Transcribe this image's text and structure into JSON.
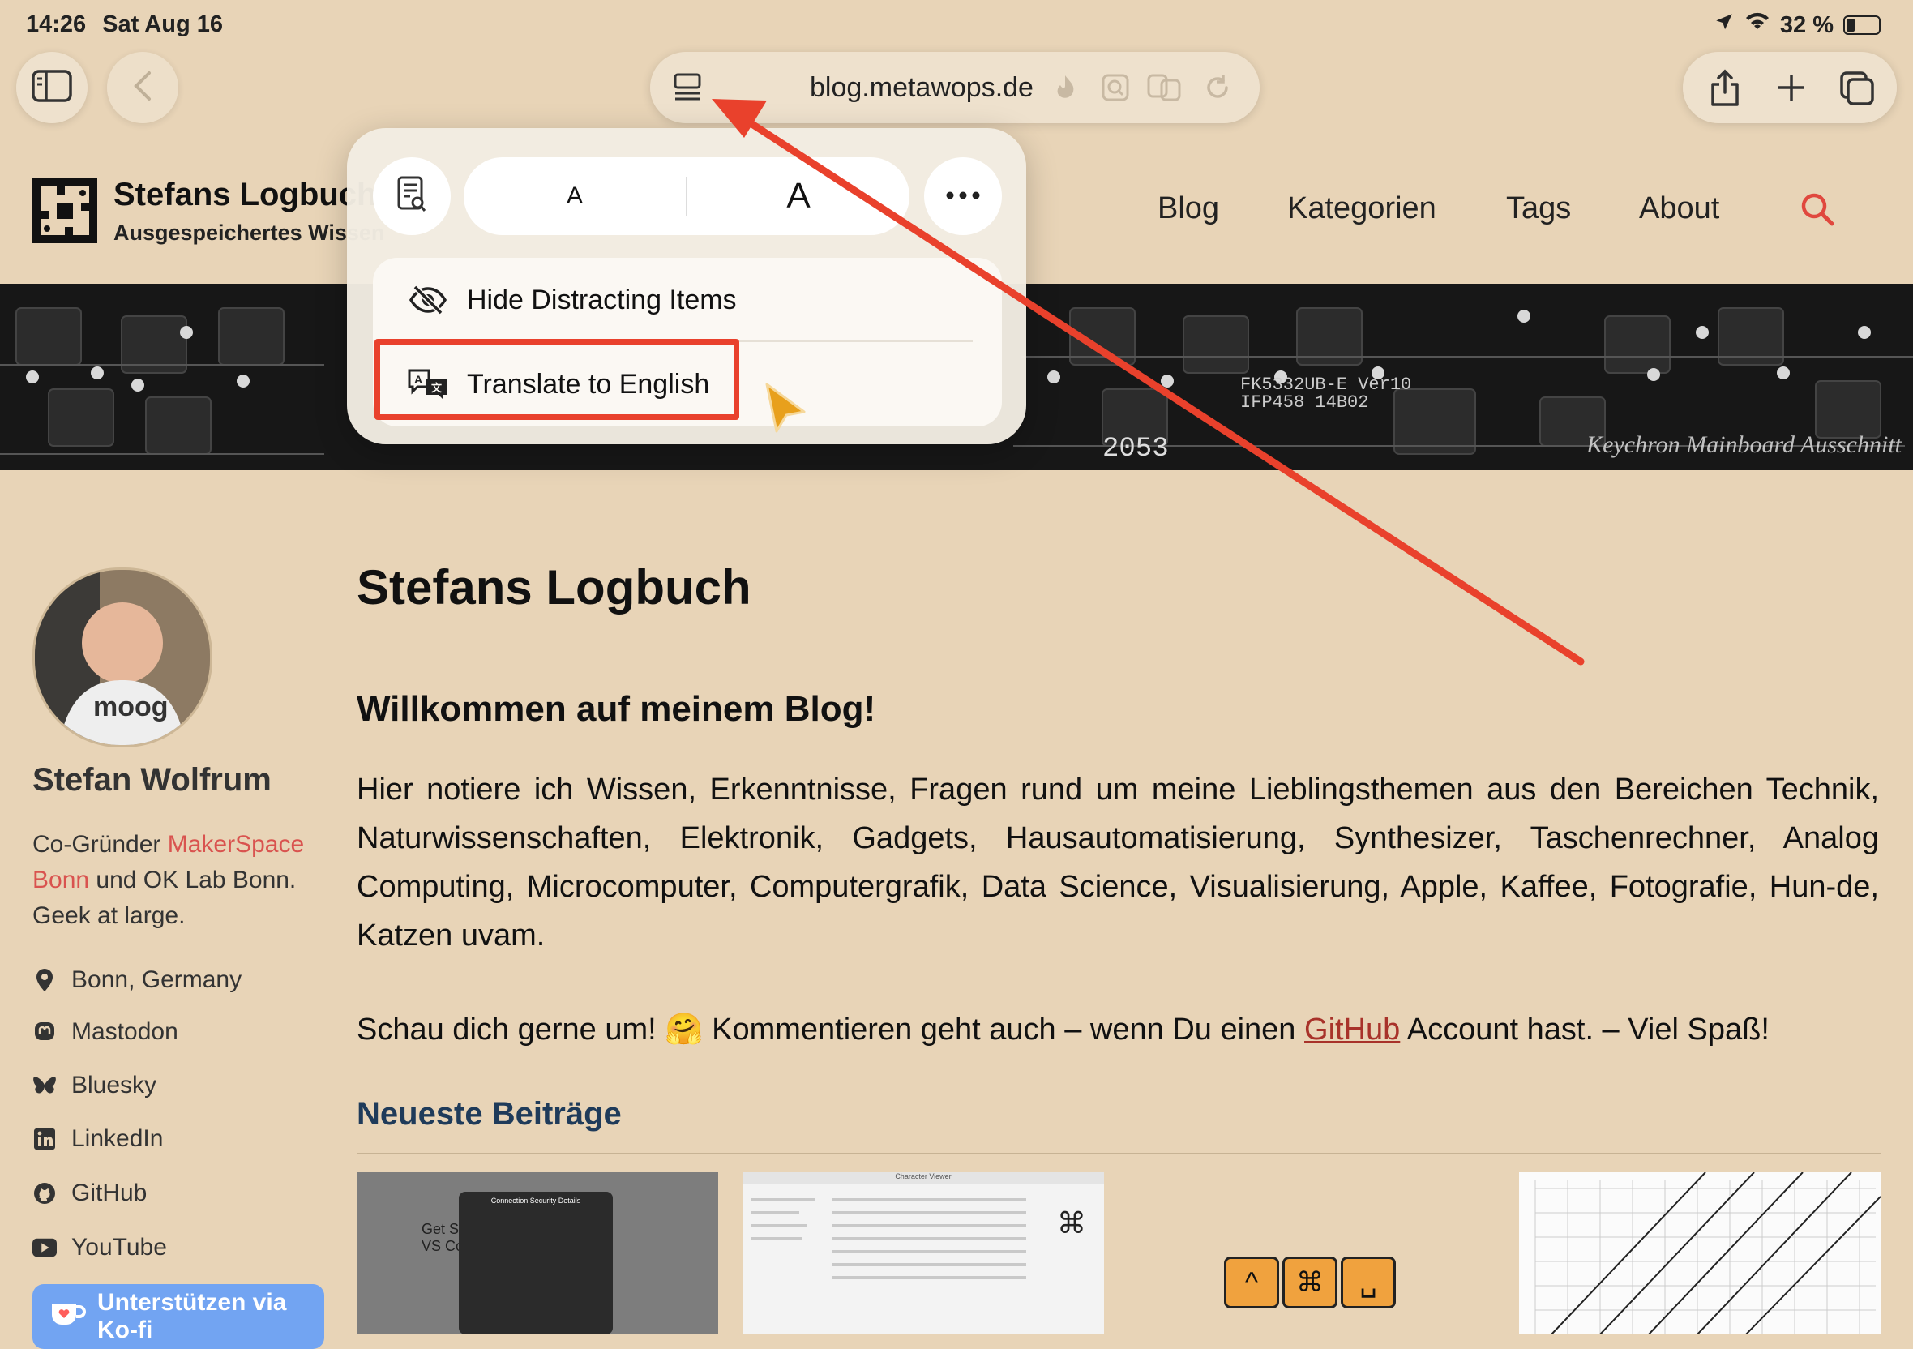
{
  "status_bar": {
    "time": "14:26",
    "date": "Sat Aug 16",
    "battery": "32 %"
  },
  "safari": {
    "url": "blog.metawops.de",
    "icons": [
      "sidebar-icon",
      "back-icon",
      "page-menu-icon",
      "extension-icon",
      "lens-icon",
      "translate-icon",
      "reload-icon",
      "share-icon",
      "new-tab-icon",
      "tabs-icon"
    ]
  },
  "site": {
    "title": "Stefans Logbuch",
    "tagline": "Ausgespeichertes Wissen",
    "nav": [
      "Blog",
      "Kategorien",
      "Tags",
      "About"
    ],
    "banner_caption": "Keychron Mainboard Ausschnitt"
  },
  "sidebar": {
    "name": "Stefan Wolfrum",
    "bio_prefix": "Co-Gründer ",
    "bio_link": "MakerSpace Bonn",
    "bio_suffix": " und OK Lab Bonn. Geek at large.",
    "links": [
      {
        "label": "Bonn, Germany",
        "icon": "location-pin-icon"
      },
      {
        "label": "Mastodon",
        "icon": "mastodon-icon"
      },
      {
        "label": "Bluesky",
        "icon": "bluesky-icon"
      },
      {
        "label": "LinkedIn",
        "icon": "linkedin-icon"
      },
      {
        "label": "GitHub",
        "icon": "github-icon"
      },
      {
        "label": "YouTube",
        "icon": "youtube-icon"
      }
    ],
    "kofi": "Unterstützen via Ko-fi"
  },
  "main": {
    "title": "Stefans Logbuch",
    "welcome": "Willkommen auf meinem Blog!",
    "intro": "Hier notiere ich Wissen, Erkenntnisse, Fragen rund um meine Lieblingsthemen aus den Bereichen Technik, Naturwissenschaften, Elektronik, Gadgets, Hausautomatisierung, Synthesizer, Taschenrechner, Analog Computing, Microcomputer, Computergrafik, Data Science, Visualisierung, Apple, Kaffee, Fotografie, Hun-de, Katzen uvam.",
    "intro2_before": "Schau dich gerne um! 🤗 Kommentieren geht auch – wenn Du einen ",
    "intro2_link": "GitHub",
    "intro2_after": " Account hast. – Viel Spaß!",
    "latest_heading": "Neueste Beiträge",
    "thumb1_text": "Get Started with VS Code Web",
    "thumb1_dialog": "Connection Security Details",
    "thumb2_title": "Character Viewer",
    "thumb3_keys": [
      "^",
      "⌘",
      "␣"
    ]
  },
  "popover": {
    "font_small": "A",
    "font_large": "A",
    "items": [
      "Hide Distracting Items",
      "Translate to English"
    ]
  },
  "colors": {
    "page_bg": "#e8d4b7",
    "accent_link": "#d9534f",
    "annotation": "#e9412c",
    "heading_blue": "#1f3b5a"
  }
}
